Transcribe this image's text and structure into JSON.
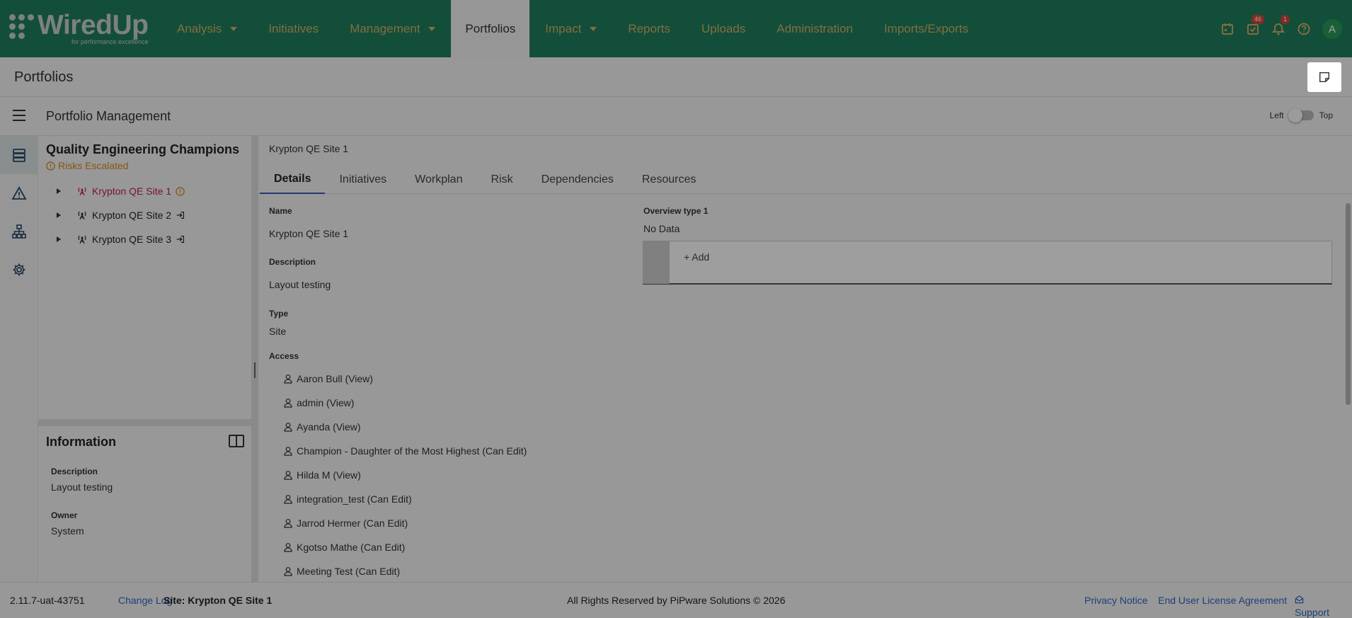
{
  "brand": {
    "name": "WiredUp",
    "tagline": "for performance excellence"
  },
  "nav": {
    "items": [
      {
        "label": "Analysis",
        "dropdown": true
      },
      {
        "label": "Initiatives",
        "dropdown": false
      },
      {
        "label": "Management",
        "dropdown": true
      },
      {
        "label": "Portfolios",
        "dropdown": false,
        "active": true
      },
      {
        "label": "Impact",
        "dropdown": true
      },
      {
        "label": "Reports",
        "dropdown": false
      },
      {
        "label": "Uploads",
        "dropdown": false
      },
      {
        "label": "Administration",
        "dropdown": false
      },
      {
        "label": "Imports/Exports",
        "dropdown": false
      }
    ],
    "tasks_badge": "46",
    "notifications_badge": "1",
    "avatar_initial": "A"
  },
  "page": {
    "title": "Portfolios"
  },
  "subheader": {
    "title": "Portfolio Management",
    "toggle_left": "Left",
    "toggle_right": "Top"
  },
  "tree": {
    "group_name": "Quality Engineering Champions",
    "group_status": "Risks Escalated",
    "items": [
      {
        "label": "Krypton QE Site 1"
      },
      {
        "label": "Krypton QE Site 2"
      },
      {
        "label": "Krypton QE Site 3"
      }
    ]
  },
  "info": {
    "heading": "Information",
    "description_label": "Description",
    "description_value": "Layout testing",
    "owner_label": "Owner",
    "owner_value": "System"
  },
  "main": {
    "breadcrumb": "Krypton QE Site 1",
    "tabs": [
      "Details",
      "Initiatives",
      "Workplan",
      "Risk",
      "Dependencies",
      "Resources"
    ],
    "name_label": "Name",
    "name_value": "Krypton QE Site 1",
    "description_label": "Description",
    "description_value": "Layout testing",
    "type_label": "Type",
    "type_value": "Site",
    "access_label": "Access",
    "access": [
      "Aaron Bull (View)",
      "admin (View)",
      "Ayanda (View)",
      "Champion - Daughter of the Most Highest (Can Edit)",
      "Hilda M (View)",
      "integration_test (Can Edit)",
      "Jarrod Hermer (Can Edit)",
      "Kgotso Mathe (Can Edit)",
      "Meeting Test (Can Edit)"
    ],
    "overview_label": "Overview type 1",
    "overview_value": "No Data",
    "add_label": "+ Add"
  },
  "footer": {
    "version": "2.11.7-uat-43751",
    "change_log": "Change Log",
    "site": "Site: Krypton QE Site 1",
    "copyright": "All Rights Reserved by PiPware Solutions © 2026",
    "privacy": "Privacy Notice",
    "eula": "End User License Agreement",
    "support": "Support"
  },
  "colors": {
    "nav_bg": "#1f7f5e",
    "nav_text": "#d4b06a",
    "warning": "#d98b1d",
    "selected": "#c0234a",
    "link": "#2f68c2"
  }
}
